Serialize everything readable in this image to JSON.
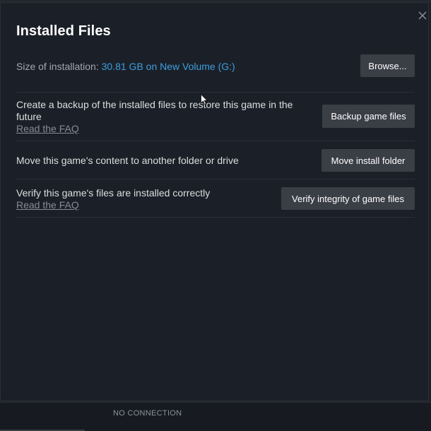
{
  "dialog": {
    "title": "Installed Files",
    "close_icon": "close-icon"
  },
  "size_row": {
    "label": "Size of installation: ",
    "value": "30.81 GB on New Volume (G:)",
    "button": "Browse..."
  },
  "backup_row": {
    "text": "Create a backup of the installed files to restore this game in the future",
    "link": "Read the FAQ",
    "button": "Backup game files"
  },
  "move_row": {
    "text": "Move this game's content to another folder or drive",
    "button": "Move install folder"
  },
  "verify_row": {
    "text": "Verify this game's files are installed correctly",
    "link": "Read the FAQ",
    "button": "Verify integrity of game files"
  },
  "status_bar": {
    "connection": "NO CONNECTION"
  },
  "colors": {
    "accent_blue": "#3f9ee0",
    "panel_bg": "#1b2028",
    "button_bg": "#3a3e45"
  }
}
